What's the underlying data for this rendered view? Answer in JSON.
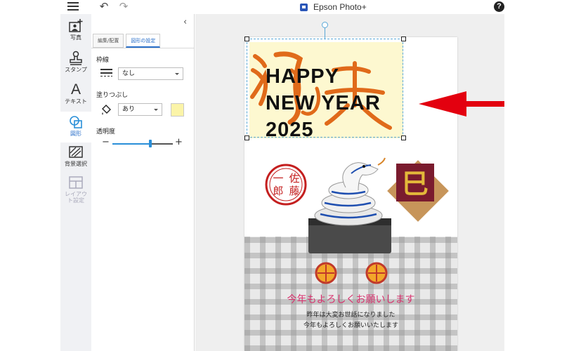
{
  "app": {
    "title": "Epson Photo+",
    "help_label": "?"
  },
  "toolbar": {
    "undo_label": "↶",
    "redo_label": "↷"
  },
  "rail": {
    "items": [
      {
        "label": "写真",
        "icon": "add-photo-icon"
      },
      {
        "label": "スタンプ",
        "icon": "stamp-icon"
      },
      {
        "label": "テキスト",
        "icon": "text-icon",
        "glyph": "A"
      },
      {
        "label": "図形",
        "icon": "shapes-icon",
        "active": true
      },
      {
        "label": "背景選択",
        "icon": "background-icon"
      },
      {
        "label": "レイアウト設定",
        "icon": "layout-icon",
        "disabled": true
      }
    ]
  },
  "panel": {
    "collapse_label": "‹",
    "tabs": [
      {
        "label": "編集/配置",
        "active": false
      },
      {
        "label": "図形の設定",
        "active": true
      }
    ],
    "border_label": "枠線",
    "border_value": "なし",
    "fill_label": "塗りつぶし",
    "fill_value": "あり",
    "fill_color": "#fbf4a8",
    "opacity_label": "透明度",
    "opacity_minus": "−",
    "opacity_plus": "+",
    "opacity_value": 0.63
  },
  "card": {
    "headline_lines": [
      "HAPPY",
      "NEW YEAR",
      "2025"
    ],
    "stamp_text": "佐藤一郎",
    "badge_text": "巳",
    "greeting": "今年もよろしくお願いします",
    "sub_line_1": "昨年は大変お世話になりました",
    "sub_line_2": "今年もよろしくお願いいたします"
  },
  "colors": {
    "accent": "#2a6fc9",
    "selection": "#5aa7d6",
    "greeting": "#d8326e",
    "arrow": "#e3000f",
    "brush": "#e06a1a"
  }
}
